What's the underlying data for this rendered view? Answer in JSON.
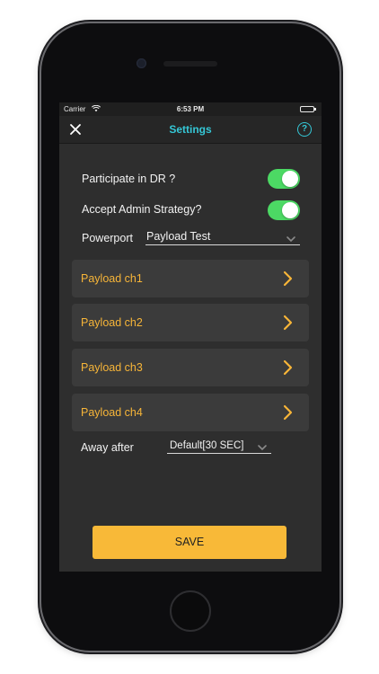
{
  "status_bar": {
    "carrier": "Carrier",
    "time": "6:53 PM"
  },
  "navbar": {
    "title": "Settings",
    "help_label": "?"
  },
  "settings": {
    "participate_dr": {
      "label": "Participate in DR ?",
      "enabled": true
    },
    "accept_admin": {
      "label": "Accept Admin Strategy?",
      "enabled": true
    },
    "powerport": {
      "label": "Powerport",
      "value": "Payload Test"
    },
    "payloads": [
      {
        "label": "Payload ch1"
      },
      {
        "label": "Payload ch2"
      },
      {
        "label": "Payload ch3"
      },
      {
        "label": "Payload ch4"
      }
    ],
    "away_after": {
      "label": "Away after",
      "value": "Default[30 SEC]"
    }
  },
  "actions": {
    "save_label": "SAVE"
  },
  "colors": {
    "accent": "#35c7d6",
    "toggle_on": "#4cd964",
    "payload_text": "#f7b538",
    "save_button": "#f8b938",
    "background": "#2e2e2e"
  },
  "icons": {
    "close": "close-icon",
    "help": "help-icon",
    "chevron_down": "chevron-down-icon",
    "chevron_right": "chevron-right-icon",
    "wifi": "wifi-icon",
    "battery": "battery-icon"
  }
}
